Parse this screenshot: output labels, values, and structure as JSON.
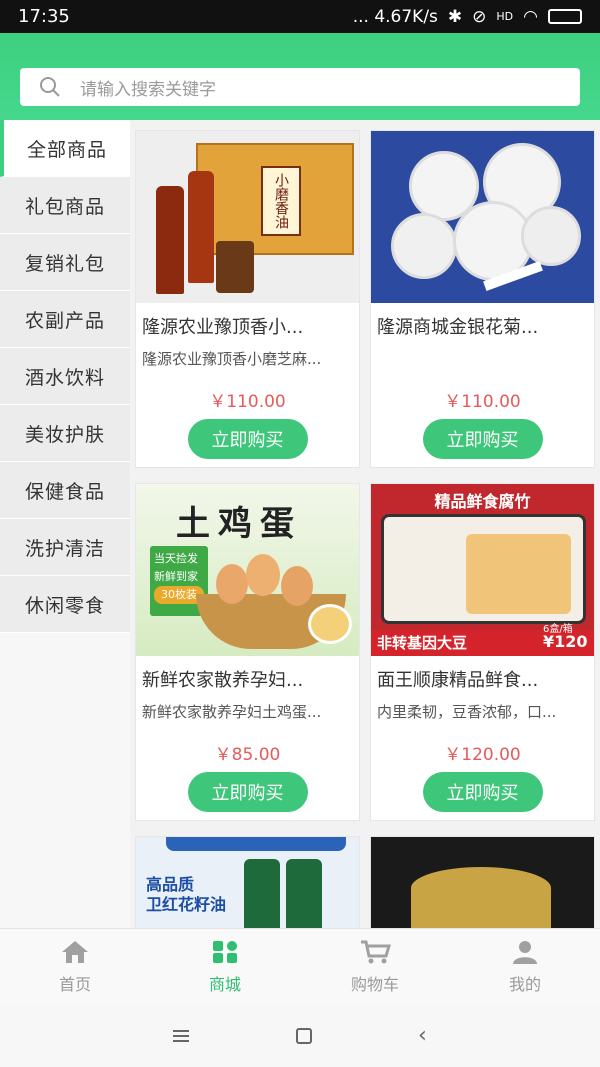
{
  "status": {
    "time": "17:35",
    "network": "... 4.67K/s",
    "icons": [
      "bluetooth-icon",
      "mute-icon",
      "hd-icon",
      "wifi-icon",
      "battery-icon"
    ]
  },
  "search": {
    "placeholder": "请输入搜索关键字"
  },
  "sidebar": {
    "items": [
      {
        "label": "全部商品",
        "active": true
      },
      {
        "label": "礼包商品"
      },
      {
        "label": "复销礼包"
      },
      {
        "label": "农副产品"
      },
      {
        "label": "酒水饮料"
      },
      {
        "label": "美妆护肤"
      },
      {
        "label": "保健食品"
      },
      {
        "label": "洗护清洁"
      },
      {
        "label": "休闲零食"
      }
    ]
  },
  "products": [
    {
      "title": "隆源农业豫顶香小...",
      "desc": "隆源农业豫顶香小磨芝麻...",
      "price": "￥110.00",
      "buy": "立即购买",
      "image_text": [
        "小磨香油"
      ]
    },
    {
      "title": "隆源商城金银花菊...",
      "desc": "",
      "price": "￥110.00",
      "buy": "立即购买",
      "image_text": []
    },
    {
      "title": "新鲜农家散养孕妇...",
      "desc": "新鲜农家散养孕妇土鸡蛋...",
      "price": "￥85.00",
      "buy": "立即购买",
      "image_text": [
        "土鸡蛋",
        "当天捡发",
        "新鲜到家",
        "30枚装"
      ]
    },
    {
      "title": "面王顺康精品鲜食...",
      "desc": "内里柔韧，豆香浓郁，口...",
      "price": "￥120.00",
      "buy": "立即购买",
      "image_text": [
        "精品鲜食腐竹",
        "非转基因大豆",
        "6盒/箱",
        "¥120"
      ]
    },
    {
      "image_text": [
        "高品质",
        "卫红花籽油"
      ]
    },
    {
      "image_text": []
    }
  ],
  "bottom_nav": [
    {
      "label": "首页",
      "icon": "home-icon"
    },
    {
      "label": "商城",
      "icon": "mall-icon",
      "active": true
    },
    {
      "label": "购物车",
      "icon": "cart-icon"
    },
    {
      "label": "我的",
      "icon": "user-icon"
    }
  ],
  "colors": {
    "accent": "#3ecf80",
    "price": "#e85a5a",
    "button": "#3ec67a"
  }
}
